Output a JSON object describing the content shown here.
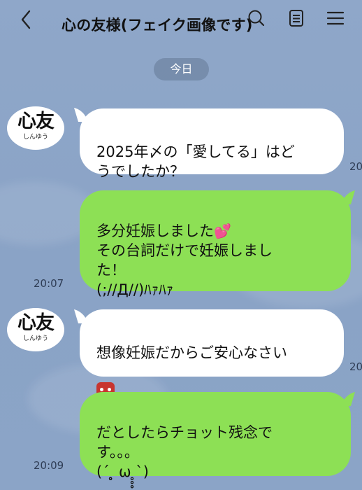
{
  "header": {
    "title": "心の友様(フェイク画像です)"
  },
  "date_chip": "今日",
  "avatar": {
    "big": "心友",
    "small": "しんゆう"
  },
  "messages": [
    {
      "side": "in",
      "text": "2025年〆の「愛してる」はど\nうでしたか？",
      "time": "20"
    },
    {
      "side": "out",
      "text_a": "多分妊娠しました",
      "heart": "💕",
      "text_b": "\nその台詞だけで妊娠しまし\nた！\n(;//Д//)ﾊｧﾊｧ",
      "time": "20:07"
    },
    {
      "side": "in",
      "text": "想像妊娠だからご安心なさい",
      "emoji": "👹",
      "time": "20"
    },
    {
      "side": "out",
      "text": "だとしたらチョット残念で\nす。。。\n(´ ̥̥̥ ω ̥̥̥`)",
      "time": "20:09"
    }
  ],
  "icons": {
    "back": "chevron-left-icon",
    "search": "search-icon",
    "notes": "notes-icon",
    "menu": "hamburger-menu-icon"
  }
}
